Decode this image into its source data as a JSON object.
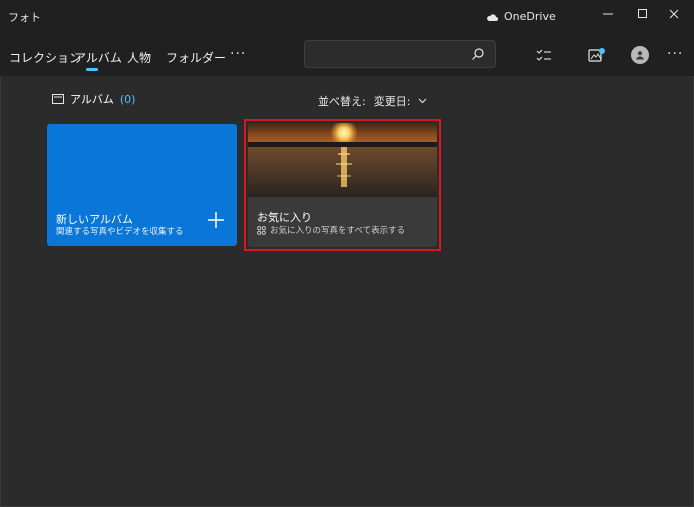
{
  "app": {
    "title": "フォト"
  },
  "onedrive": {
    "label": "OneDrive"
  },
  "nav": {
    "tabs": [
      {
        "label": "コレクション"
      },
      {
        "label": "アルバム"
      },
      {
        "label": "人物"
      },
      {
        "label": "フォルダー"
      }
    ],
    "more": "···"
  },
  "search": {
    "value": "",
    "placeholder": ""
  },
  "header_more": "···",
  "section": {
    "title": "アルバム",
    "count": "(0)"
  },
  "sort": {
    "label": "並べ替え:",
    "value": "変更日:"
  },
  "albums": {
    "new": {
      "title": "新しいアルバム",
      "subtitle": "関連する写真やビデオを収集する"
    },
    "favorites": {
      "title": "お気に入り",
      "subtitle": "お気に入りの写真をすべて表示する"
    }
  },
  "colors": {
    "accent": "#4cc2ff",
    "new_album_tile": "#0a76d8",
    "highlight": "#d8171e"
  }
}
